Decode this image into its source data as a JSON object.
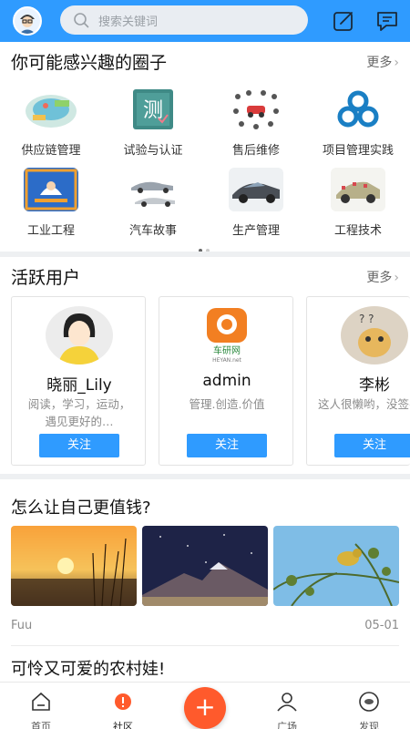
{
  "search": {
    "placeholder": "搜索关键词"
  },
  "circles_section": {
    "title": "你可能感兴趣的圈子",
    "more": "更多",
    "items": [
      {
        "label": "供应链管理"
      },
      {
        "label": "试验与认证"
      },
      {
        "label": "售后维修"
      },
      {
        "label": "项目管理实践"
      },
      {
        "label": "工业工程"
      },
      {
        "label": "汽车故事"
      },
      {
        "label": "生产管理"
      },
      {
        "label": "工程技术"
      }
    ],
    "pager": {
      "current": 1,
      "total": 2
    }
  },
  "users_section": {
    "title": "活跃用户",
    "more": "更多",
    "users": [
      {
        "name": "晓丽_Lily",
        "bio": "阅读，学习，运动，遇见更好的…",
        "follow": "关注"
      },
      {
        "name": "admin",
        "bio": "管理.创造.价值",
        "follow": "关注",
        "logo_text": "车研网",
        "logo_sub": "HEYAN.net"
      },
      {
        "name": "李彬",
        "bio": "这人很懒哟，没签名!",
        "follow": "关注"
      }
    ]
  },
  "feed": {
    "post1": {
      "title": "怎么让自己更值钱?",
      "author": "Fuu",
      "date": "05-01"
    },
    "post2": {
      "title": "可怜又可爱的农村娃!"
    }
  },
  "nav": {
    "items": [
      {
        "label": "首页"
      },
      {
        "label": "社区"
      },
      {
        "label": "广场"
      },
      {
        "label": "发现"
      }
    ],
    "plus": "+"
  },
  "colors": {
    "primary": "#2f9bff",
    "accent": "#ff5a2c"
  }
}
